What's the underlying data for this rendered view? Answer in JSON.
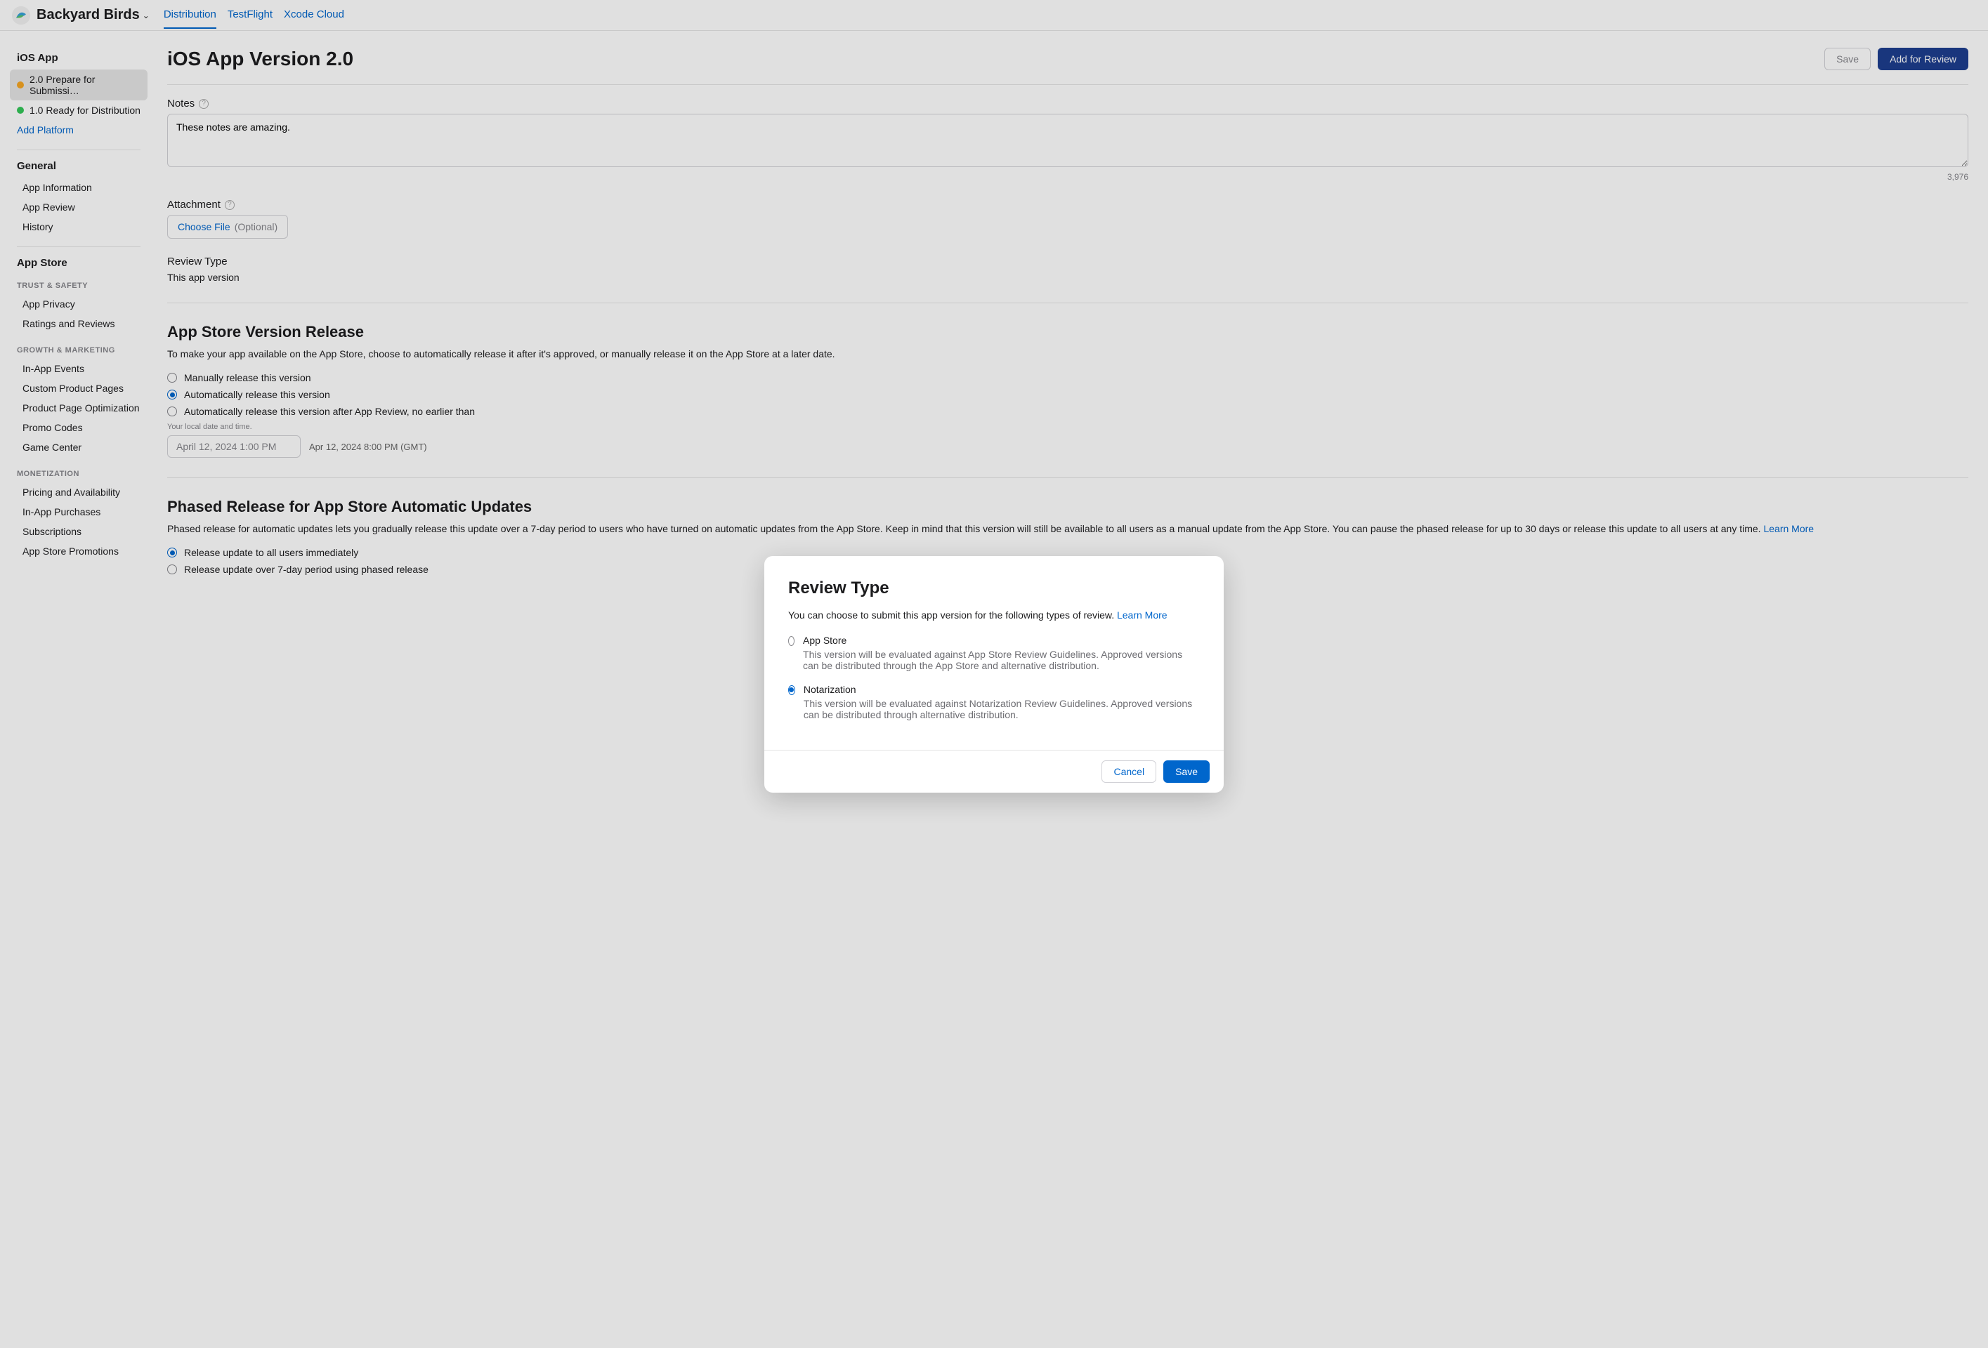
{
  "header": {
    "app_name": "Backyard Birds",
    "tabs": [
      "Distribution",
      "TestFlight",
      "Xcode Cloud"
    ]
  },
  "sidebar": {
    "platform_heading": "iOS App",
    "versions": [
      {
        "label": "2.0 Prepare for Submissi…",
        "status": "amber"
      },
      {
        "label": "1.0 Ready for Distribution",
        "status": "green"
      }
    ],
    "add_platform": "Add Platform",
    "general_heading": "General",
    "general_items": [
      "App Information",
      "App Review",
      "History"
    ],
    "appstore_heading": "App Store",
    "trust_cat": "TRUST & SAFETY",
    "trust_items": [
      "App Privacy",
      "Ratings and Reviews"
    ],
    "growth_cat": "GROWTH & MARKETING",
    "growth_items": [
      "In-App Events",
      "Custom Product Pages",
      "Product Page Optimization",
      "Promo Codes",
      "Game Center"
    ],
    "monet_cat": "MONETIZATION",
    "monet_items": [
      "Pricing and Availability",
      "In-App Purchases",
      "Subscriptions",
      "App Store Promotions"
    ]
  },
  "page": {
    "title": "iOS App Version 2.0",
    "save_btn": "Save",
    "add_review_btn": "Add for Review",
    "notes_label": "Notes",
    "notes_value": "These notes are amazing.",
    "notes_count": "3,976",
    "attachment_label": "Attachment",
    "choose_file": "Choose File",
    "choose_hint": "(Optional)",
    "review_type_label": "Review Type",
    "review_type_value": "This app version ",
    "version_release_title": "App Store Version Release",
    "version_release_desc": "To make your app available on the App Store, choose to automatically release it after it's approved, or manually release it on the App Store at a later date.",
    "release_options": [
      "Manually release this version",
      "Automatically release this version",
      "Automatically release this version after App Review, no earlier than"
    ],
    "date_hint": "Your local date and time.",
    "date_value": "April 12, 2024 1:00 PM",
    "date_gmt": "Apr 12, 2024 8:00 PM (GMT)",
    "phased_title": "Phased Release for App Store Automatic Updates",
    "phased_desc": "Phased release for automatic updates lets you gradually release this update over a 7-day period to users who have turned on automatic updates from the App Store. Keep in mind that this version will still be available to all users as a manual update from the App Store. You can pause the phased release for up to 30 days or release this update to all users at any time. ",
    "learn_more": "Learn More",
    "phased_options": [
      "Release update to all users immediately",
      "Release update over 7-day period using phased release"
    ]
  },
  "modal": {
    "title": "Review Type",
    "desc": "You can choose to submit this app version for the following types of review. ",
    "learn_more": "Learn More",
    "options": [
      {
        "title": "App Store",
        "desc": "This version will be evaluated against App Store Review Guidelines. Approved versions can be distributed through the App Store and alternative distribution."
      },
      {
        "title": "Notarization",
        "desc": "This version will be evaluated against Notarization Review Guidelines. Approved versions can be distributed through alternative distribution."
      }
    ],
    "cancel": "Cancel",
    "save": "Save"
  }
}
